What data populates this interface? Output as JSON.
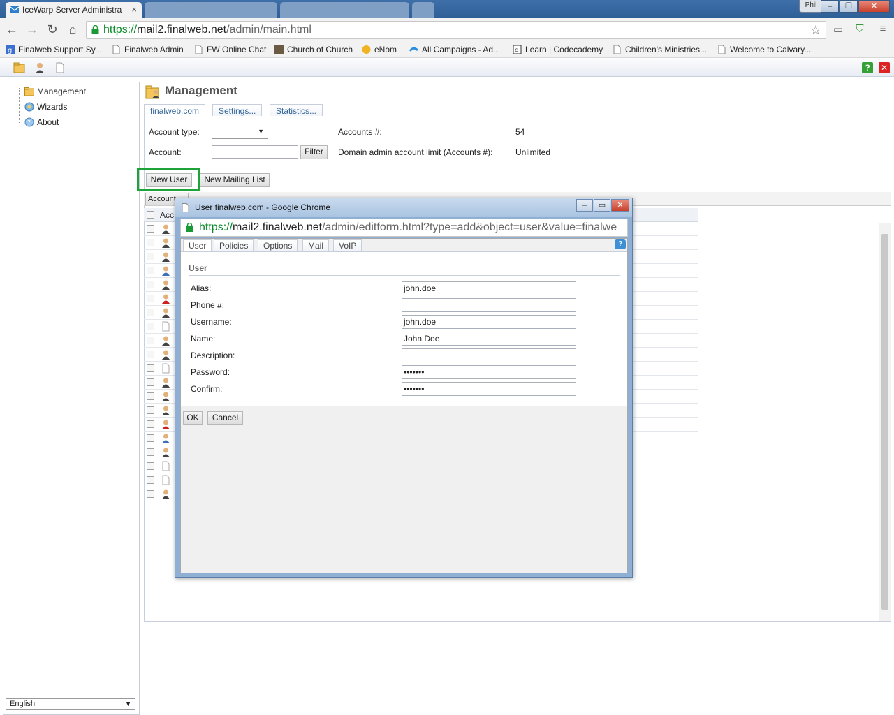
{
  "browser": {
    "tabs": [
      {
        "label": "IceWarp Server Administra",
        "active": true
      },
      {
        "label": "",
        "active": false
      },
      {
        "label": "",
        "active": false
      }
    ],
    "profile": "Phil",
    "url": {
      "scheme": "https://",
      "host": "mail2.finalweb.net",
      "path": "/admin/main.html"
    },
    "bookmarks": [
      "Finalweb Support Sy...",
      "Finalweb Admin",
      "FW Online Chat",
      "Church of Church",
      "eNom",
      "All Campaigns - Ad...",
      "Learn | Codecademy",
      "Children's Ministries...",
      "Welcome to Calvary..."
    ]
  },
  "tree": {
    "items": [
      "Management",
      "Wizards",
      "About"
    ],
    "language": "English"
  },
  "management": {
    "title": "Management",
    "tabs": [
      "finalweb.com",
      "Settings...",
      "Statistics..."
    ],
    "account_type_label": "Account type:",
    "account_label": "Account:",
    "filter_button": "Filter",
    "accounts_count_label": "Accounts #:",
    "accounts_count_value": "54",
    "domain_limit_label": "Domain admin account limit (Accounts #):",
    "domain_limit_value": "Unlimited",
    "new_user_button": "New User",
    "new_mailing_list_button": "New Mailing List",
    "list_filter_label": "Account",
    "column_header": "Acc"
  },
  "popup": {
    "window_title": "User finalweb.com - Google Chrome",
    "url": {
      "scheme": "https://",
      "host": "mail2.finalweb.net",
      "path": "/admin/editform.html?type=add&object=user&value=finalwe"
    },
    "tabs": [
      "User",
      "Policies",
      "Options",
      "Mail",
      "VoIP"
    ],
    "section": "User",
    "fields": [
      {
        "label": "Alias:",
        "value": "john.doe"
      },
      {
        "label": "Phone #:",
        "value": ""
      },
      {
        "label": "Username:",
        "value": "john.doe"
      },
      {
        "label": "Name:",
        "value": "John Doe"
      },
      {
        "label": "Description:",
        "value": ""
      },
      {
        "label": "Password:",
        "value": "•••••••"
      },
      {
        "label": "Confirm:",
        "value": "•••••••"
      }
    ],
    "ok_button": "OK",
    "cancel_button": "Cancel"
  },
  "colors": {
    "highlight": "#1ea33a",
    "link": "#336699",
    "secure": "#0a8a2a"
  }
}
